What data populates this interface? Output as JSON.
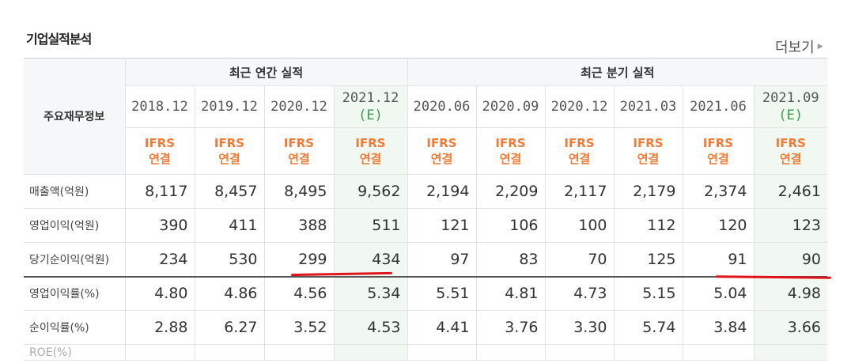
{
  "section_title": "기업실적분석",
  "more_label": "더보기",
  "header": {
    "corner_label": "주요재무정보",
    "annual_label": "최근 연간 실적",
    "quarter_label": "최근 분기 실적"
  },
  "periods": [
    {
      "date": "2018.12",
      "est": "",
      "ifrs": "IFRS",
      "basis": "연결"
    },
    {
      "date": "2019.12",
      "est": "",
      "ifrs": "IFRS",
      "basis": "연결"
    },
    {
      "date": "2020.12",
      "est": "",
      "ifrs": "IFRS",
      "basis": "연결"
    },
    {
      "date": "2021.12",
      "est": "(E)",
      "ifrs": "IFRS",
      "basis": "연결"
    },
    {
      "date": "2020.06",
      "est": "",
      "ifrs": "IFRS",
      "basis": "연결"
    },
    {
      "date": "2020.09",
      "est": "",
      "ifrs": "IFRS",
      "basis": "연결"
    },
    {
      "date": "2020.12",
      "est": "",
      "ifrs": "IFRS",
      "basis": "연결"
    },
    {
      "date": "2021.03",
      "est": "",
      "ifrs": "IFRS",
      "basis": "연결"
    },
    {
      "date": "2021.06",
      "est": "",
      "ifrs": "IFRS",
      "basis": "연결"
    },
    {
      "date": "2021.09",
      "est": "(E)",
      "ifrs": "IFRS",
      "basis": "연결"
    }
  ],
  "rows": [
    {
      "label": "매출액(억원)",
      "values": [
        "8,117",
        "8,457",
        "8,495",
        "9,562",
        "2,194",
        "2,209",
        "2,117",
        "2,179",
        "2,374",
        "2,461"
      ]
    },
    {
      "label": "영업이익(억원)",
      "values": [
        "390",
        "411",
        "388",
        "511",
        "121",
        "106",
        "100",
        "112",
        "120",
        "123"
      ]
    },
    {
      "label": "당기순이익(억원)",
      "values": [
        "234",
        "530",
        "299",
        "434",
        "97",
        "83",
        "70",
        "125",
        "91",
        "90"
      ]
    },
    {
      "label": "영업이익률(%)",
      "values": [
        "4.80",
        "4.86",
        "4.56",
        "5.34",
        "5.51",
        "4.81",
        "4.73",
        "5.15",
        "5.04",
        "4.98"
      ]
    },
    {
      "label": "순이익률(%)",
      "values": [
        "2.88",
        "6.27",
        "3.52",
        "4.53",
        "4.41",
        "3.76",
        "3.30",
        "5.74",
        "3.84",
        "3.66"
      ]
    }
  ],
  "cut_row": {
    "label": "ROE(%)"
  },
  "colors": {
    "estimate_bg": "#f0f8f1",
    "ifrs_orange": "#f07a36",
    "estimate_green": "#38a24a",
    "annotation_red": "#e0141b"
  }
}
